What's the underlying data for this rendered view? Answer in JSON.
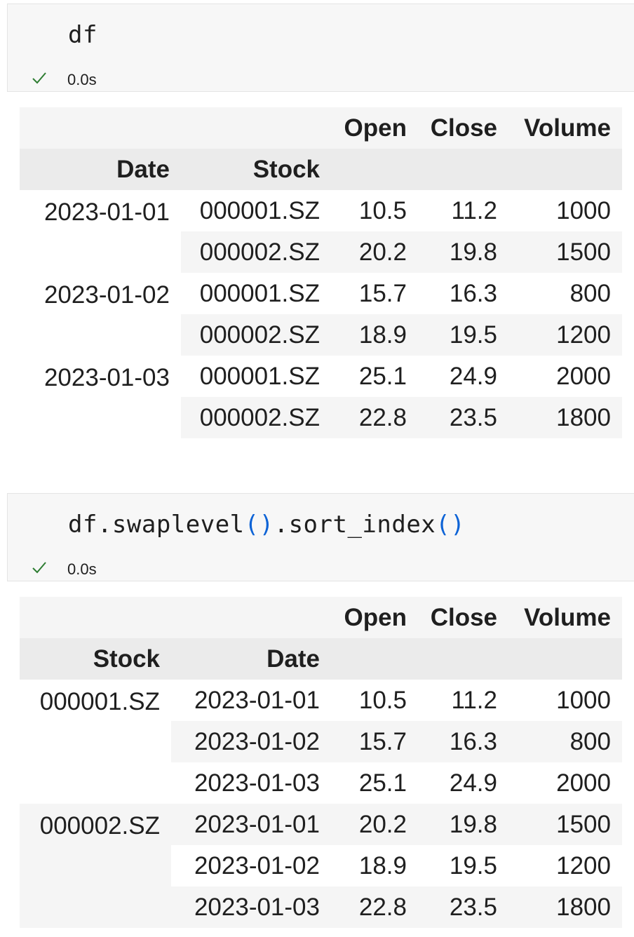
{
  "cells": [
    {
      "code": "df",
      "status_time": "0.0s",
      "output": {
        "columns": [
          "Open",
          "Close",
          "Volume"
        ],
        "index_names": [
          "Date",
          "Stock"
        ],
        "groups": [
          {
            "key": "2023-01-01",
            "rows": [
              {
                "sub": "000001.SZ",
                "values": [
                  "10.5",
                  "11.2",
                  "1000"
                ]
              },
              {
                "sub": "000002.SZ",
                "values": [
                  "20.2",
                  "19.8",
                  "1500"
                ]
              }
            ]
          },
          {
            "key": "2023-01-02",
            "rows": [
              {
                "sub": "000001.SZ",
                "values": [
                  "15.7",
                  "16.3",
                  "800"
                ]
              },
              {
                "sub": "000002.SZ",
                "values": [
                  "18.9",
                  "19.5",
                  "1200"
                ]
              }
            ]
          },
          {
            "key": "2023-01-03",
            "rows": [
              {
                "sub": "000001.SZ",
                "values": [
                  "25.1",
                  "24.9",
                  "2000"
                ]
              },
              {
                "sub": "000002.SZ",
                "values": [
                  "22.8",
                  "23.5",
                  "1800"
                ]
              }
            ]
          }
        ]
      }
    },
    {
      "code": "df.swaplevel().sort_index()",
      "code_parts": [
        "df.swaplevel",
        "()",
        ".sort_index",
        "()"
      ],
      "status_time": "0.0s",
      "output": {
        "columns": [
          "Open",
          "Close",
          "Volume"
        ],
        "index_names": [
          "Stock",
          "Date"
        ],
        "groups": [
          {
            "key": "000001.SZ",
            "rows": [
              {
                "sub": "2023-01-01",
                "values": [
                  "10.5",
                  "11.2",
                  "1000"
                ]
              },
              {
                "sub": "2023-01-02",
                "values": [
                  "15.7",
                  "16.3",
                  "800"
                ]
              },
              {
                "sub": "2023-01-03",
                "values": [
                  "25.1",
                  "24.9",
                  "2000"
                ]
              }
            ]
          },
          {
            "key": "000002.SZ",
            "rows": [
              {
                "sub": "2023-01-01",
                "values": [
                  "20.2",
                  "19.8",
                  "1500"
                ]
              },
              {
                "sub": "2023-01-02",
                "values": [
                  "18.9",
                  "19.5",
                  "1200"
                ]
              },
              {
                "sub": "2023-01-03",
                "values": [
                  "22.8",
                  "23.5",
                  "1800"
                ]
              }
            ]
          }
        ]
      }
    }
  ],
  "colors": {
    "check": "#2e7d32",
    "paren": "#0d63d6",
    "cell_bg": "#f7f7f7",
    "header_bg": "#ebebeb",
    "stripe_bg": "#f5f5f5"
  },
  "icons": {
    "status": "checkmark-icon"
  }
}
